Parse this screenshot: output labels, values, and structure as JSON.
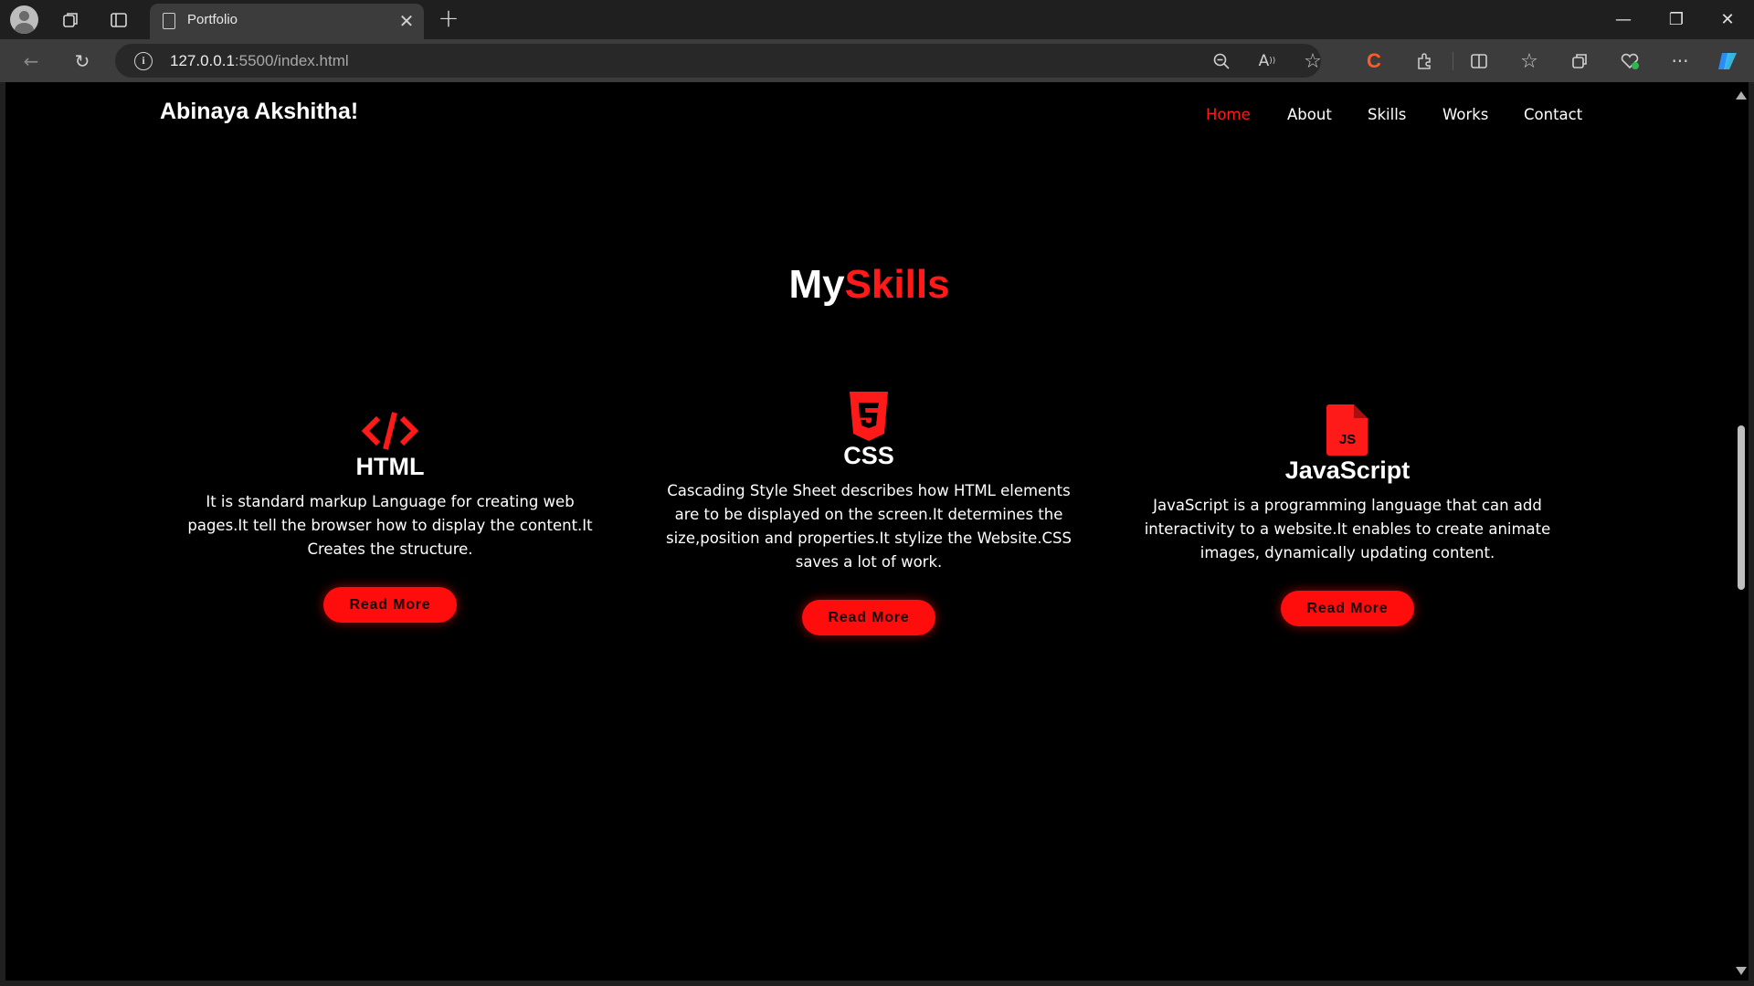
{
  "browser": {
    "tab_title": "Portfolio",
    "url_host": "127.0.0.1",
    "url_rest": ":5500/index.html"
  },
  "site": {
    "brand": "Abinaya Akshitha!",
    "nav": [
      {
        "label": "Home",
        "active": true
      },
      {
        "label": "About",
        "active": false
      },
      {
        "label": "Skills",
        "active": false
      },
      {
        "label": "Works",
        "active": false
      },
      {
        "label": "Contact",
        "active": false
      }
    ],
    "section_title_1": "My",
    "section_title_2": "Skills",
    "skills": [
      {
        "title": "HTML",
        "icon": "code-icon",
        "description": "It is standard markup Language for creating web pages.It tell the browser how to display the content.It Creates the structure.",
        "button": "Read More"
      },
      {
        "title": "CSS",
        "icon": "css3-icon",
        "description": "Cascading Style Sheet describes how HTML elements are to be displayed on the screen.It determines the size,position and properties.It stylize the Website.CSS saves a lot of work.",
        "button": "Read More"
      },
      {
        "title": "JavaScript",
        "icon": "js-file-icon",
        "description": "JavaScript is a programming language that can add interactivity to a website.It enables to create animate images, dynamically updating content.",
        "button": "Read More"
      }
    ]
  },
  "colors": {
    "accent": "#ff1a1a",
    "background": "#000000",
    "text": "#ffffff"
  }
}
